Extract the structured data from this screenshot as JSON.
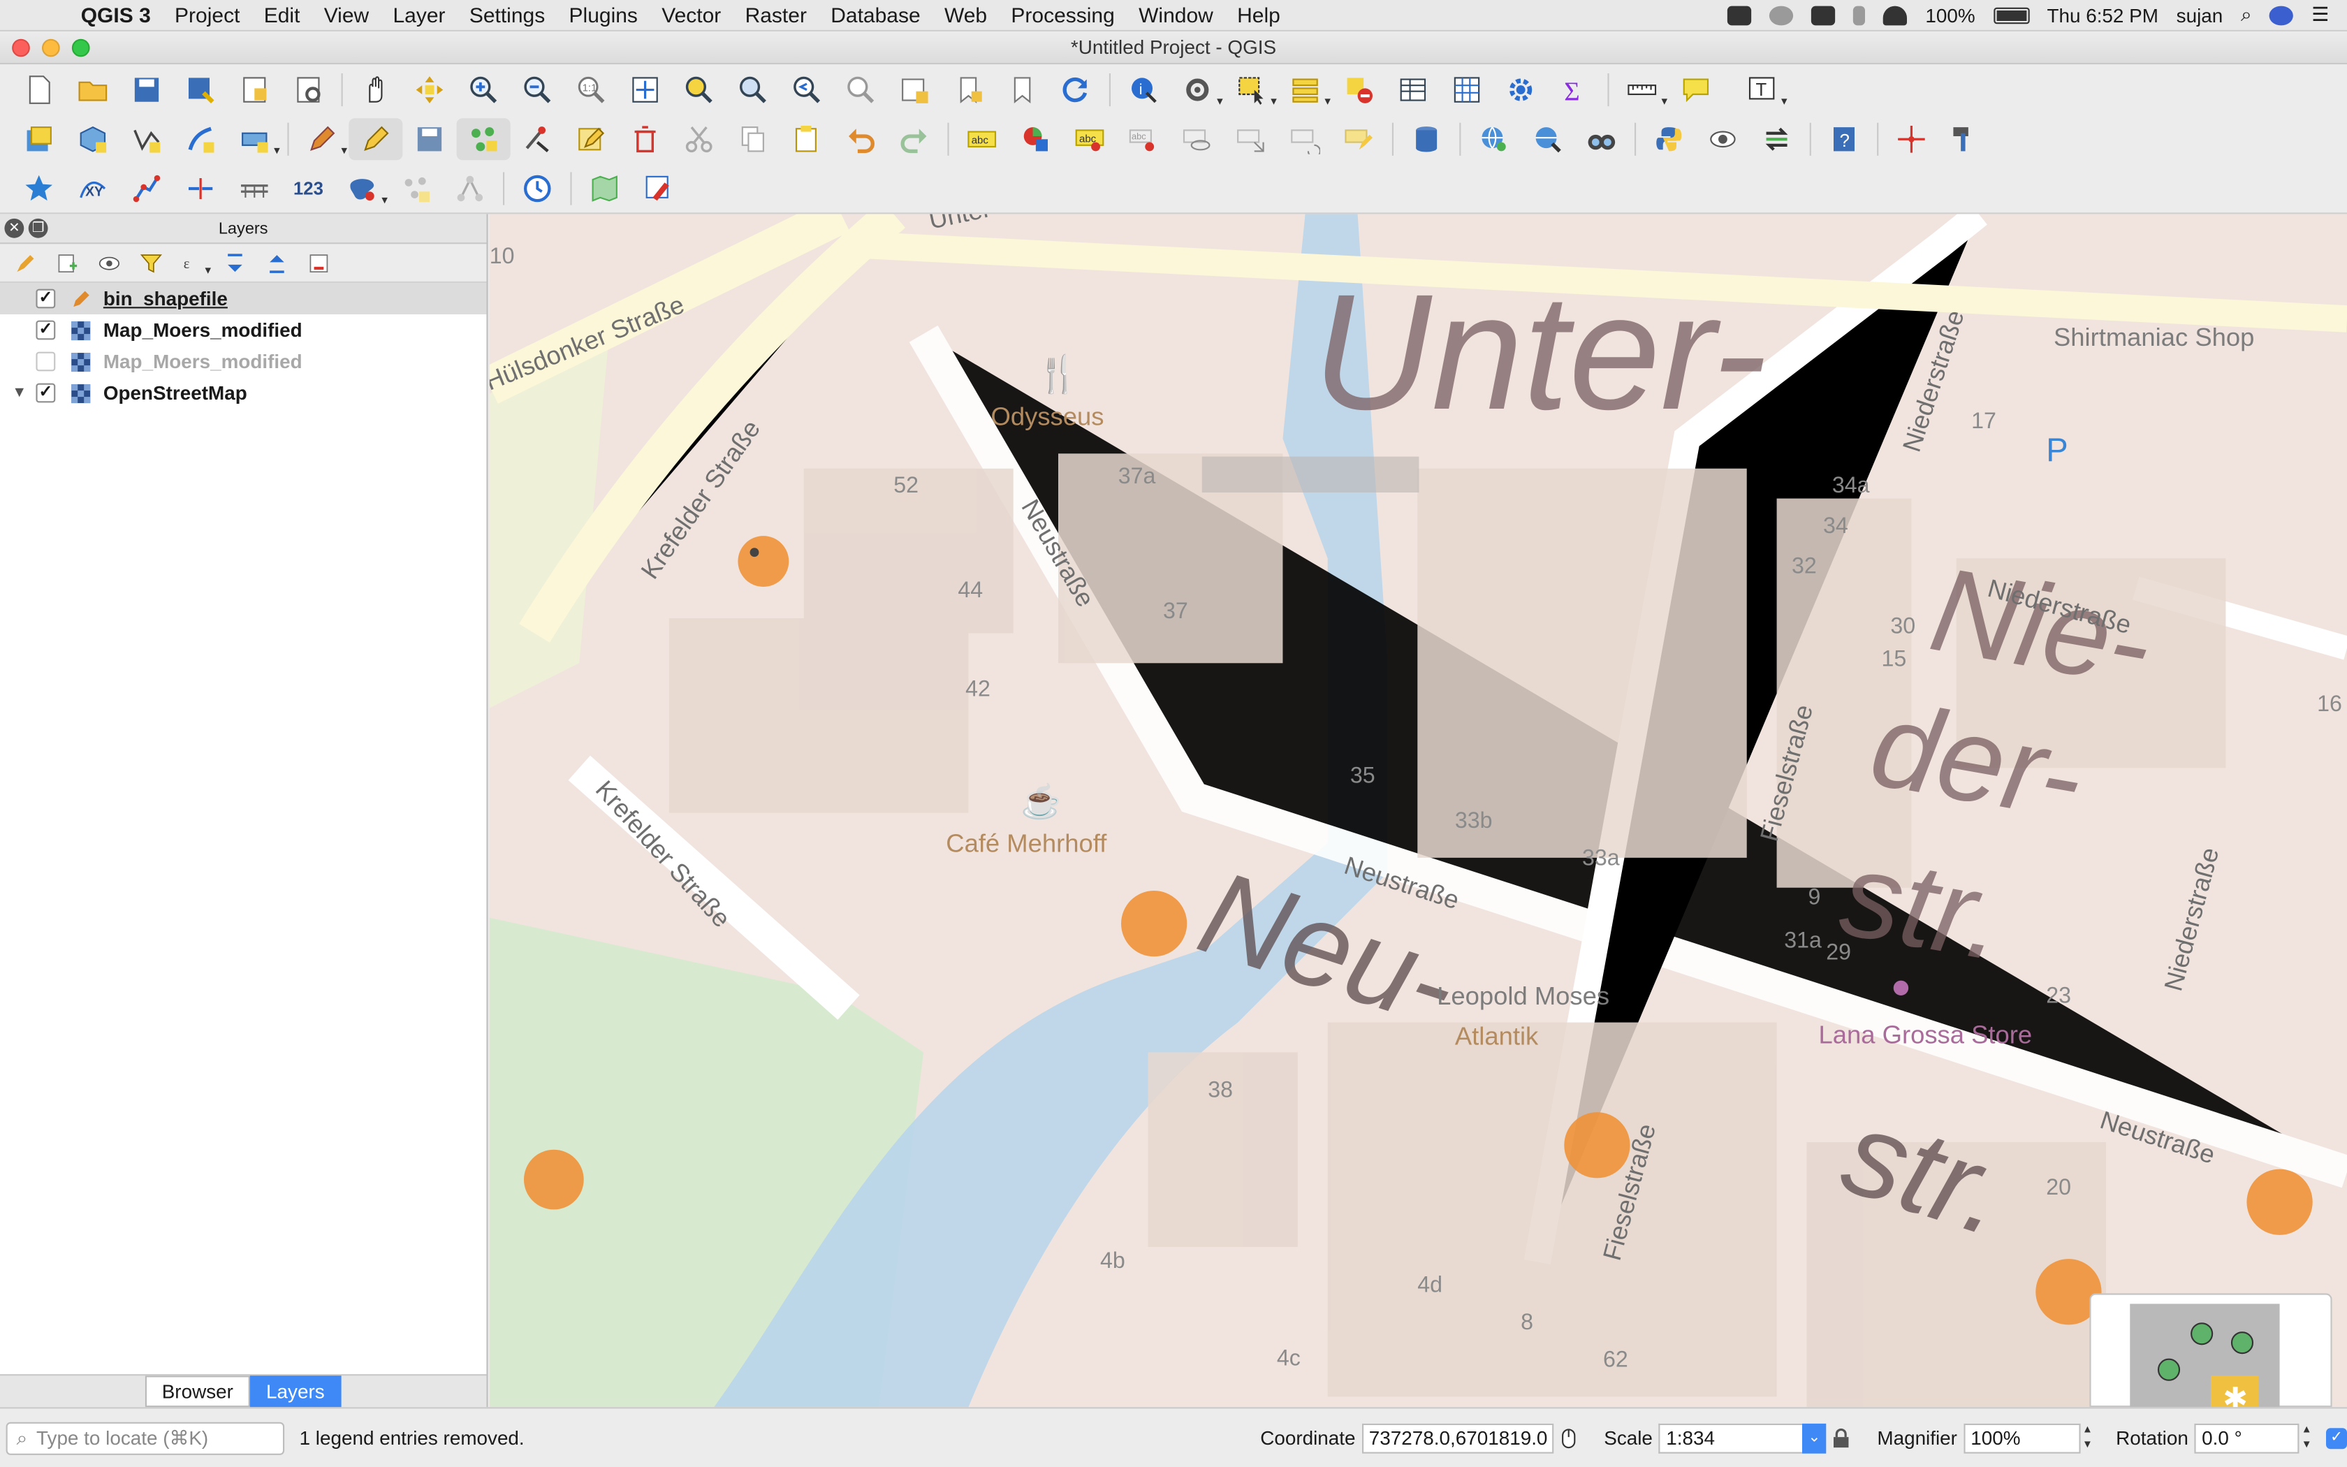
{
  "menubar": {
    "app_name": "QGIS 3",
    "items": [
      "Project",
      "Edit",
      "View",
      "Layer",
      "Settings",
      "Plugins",
      "Vector",
      "Raster",
      "Database",
      "Web",
      "Processing",
      "Window",
      "Help"
    ],
    "battery": "100%",
    "clock": "Thu 6:52 PM",
    "user": "sujan"
  },
  "window": {
    "title": "*Untitled Project - QGIS"
  },
  "layers_panel": {
    "title": "Layers",
    "layers": [
      {
        "name": "bin_shapefile",
        "checked": "✓",
        "type": "vector-point-editing"
      },
      {
        "name": "Map_Moers_modified",
        "checked": "✓",
        "type": "raster"
      },
      {
        "name": "Map_Moers_modified",
        "checked": "",
        "type": "raster"
      },
      {
        "name": "OpenStreetMap",
        "checked": "✓",
        "type": "raster",
        "expander": "▼"
      }
    ],
    "tabs": [
      "Browser",
      "Layers"
    ]
  },
  "map": {
    "labels": [
      "Hülsdonker Straße",
      "Krefelder Straße",
      "Krefelder Straße",
      "Neustraße",
      "Neustraße",
      "Neustraße",
      "Niederstraße",
      "Niederstraße",
      "Fieselstraße",
      "Fieselstraße",
      "Odysseus",
      "Café Mehrhoff",
      "Shirtmaniac Shop",
      "Lana Grossa Store",
      "Atlantik",
      "Leopold Moses",
      "Unter-",
      "Nie-",
      "der-",
      "str.",
      "Neu-",
      "str.",
      "52",
      "44",
      "42",
      "37a",
      "37",
      "38",
      "35",
      "33b",
      "33a",
      "34a",
      "34",
      "32",
      "31a",
      "30",
      "29",
      "23",
      "20",
      "17",
      "16",
      "15",
      "4b",
      "4d",
      "4c",
      "8",
      "62",
      "9",
      "10",
      "Untergraben",
      "Unter"
    ]
  },
  "status": {
    "locate_placeholder": "Type to locate (⌘K)",
    "message": "1 legend entries removed.",
    "coordinate_label": "Coordinate",
    "coordinate": "737278.0,6701819.0",
    "scale_label": "Scale",
    "scale": "1:834",
    "magnifier_label": "Magnifier",
    "magnifier": "100%",
    "rotation_label": "Rotation",
    "rotation": "0.0 °"
  },
  "colors": {
    "accent": "#3e89f6",
    "bin_points": "#f0923a",
    "river": "#a9cde8"
  }
}
